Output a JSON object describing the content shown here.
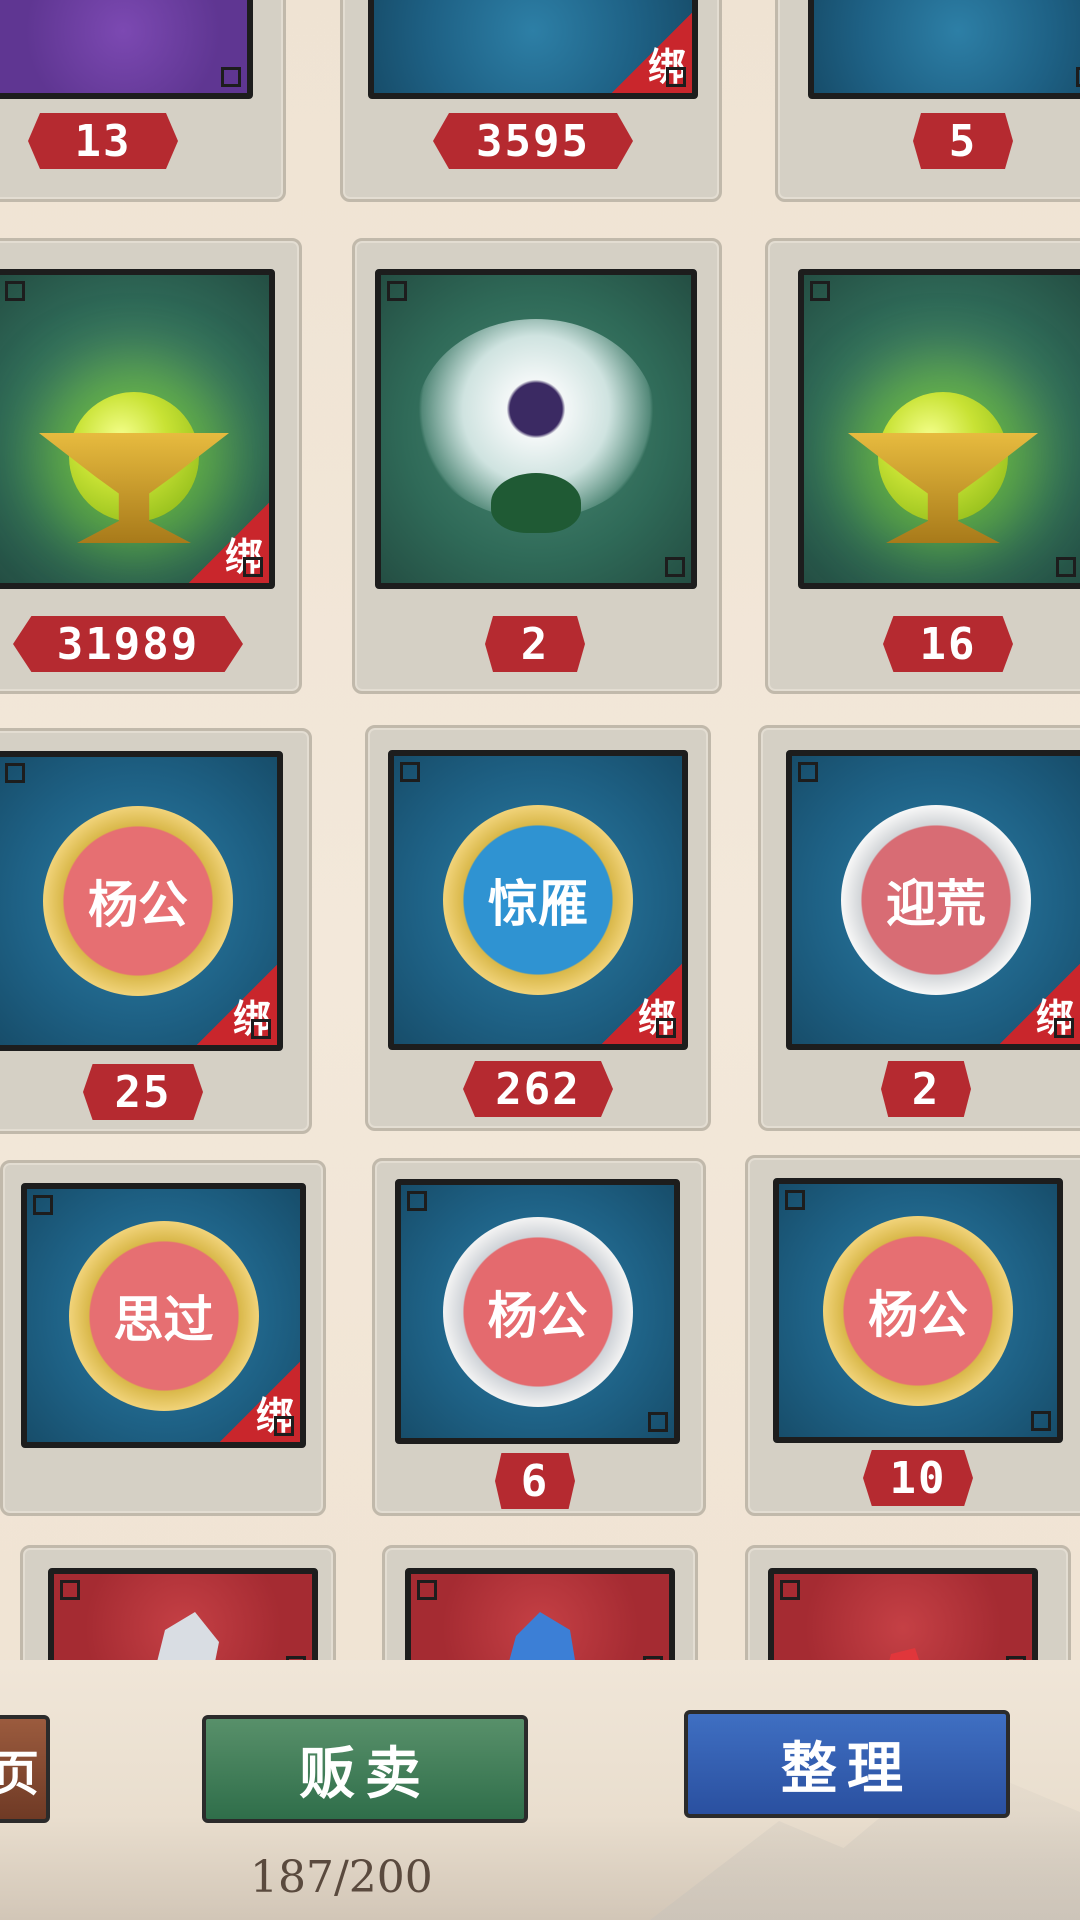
{
  "inventory": {
    "rows": [
      [
        {
          "qty": "13",
          "bound": false,
          "tile": "purple",
          "art": "cup"
        },
        {
          "qty": "3595",
          "bound": true,
          "tile": "blue",
          "art": "cup"
        },
        {
          "qty": "5",
          "bound": false,
          "tile": "blue",
          "art": "cup"
        }
      ],
      [
        {
          "qty": "31989",
          "bound": true,
          "tile": "green",
          "art": "orb-cup"
        },
        {
          "qty": "2",
          "bound": false,
          "tile": "green",
          "art": "flower"
        },
        {
          "qty": "16",
          "bound": false,
          "tile": "green",
          "art": "orb-cup"
        }
      ],
      [
        {
          "qty": "25",
          "bound": true,
          "tile": "blue",
          "art": "medal",
          "medal_text": "杨公",
          "medal_style": "gold"
        },
        {
          "qty": "262",
          "bound": true,
          "tile": "blue",
          "art": "medal",
          "medal_text": "惊雁",
          "medal_style": "gold-blue"
        },
        {
          "qty": "2",
          "bound": true,
          "tile": "blue",
          "art": "medal",
          "medal_text": "迎荒",
          "medal_style": "silver-red"
        }
      ],
      [
        {
          "qty": "",
          "bound": true,
          "tile": "blue",
          "art": "medal",
          "medal_text": "思过",
          "medal_style": "gold"
        },
        {
          "qty": "6",
          "bound": false,
          "tile": "blue",
          "art": "medal",
          "medal_text": "杨公",
          "medal_style": "silver"
        },
        {
          "qty": "10",
          "bound": false,
          "tile": "blue",
          "art": "medal",
          "medal_text": "杨公",
          "medal_style": "gold"
        }
      ],
      [
        {
          "qty": "",
          "bound": false,
          "tile": "red",
          "art": "shard-white"
        },
        {
          "qty": "",
          "bound": false,
          "tile": "red",
          "art": "shard-blue"
        },
        {
          "qty": "",
          "bound": false,
          "tile": "red",
          "art": "shard-red"
        }
      ]
    ],
    "bind_label": "绑"
  },
  "actions": {
    "left_partial_label": "页",
    "sell_label": "贩卖",
    "sort_label": "整理"
  },
  "capacity": "187/200",
  "colors": {
    "qty_badge": "#b52a30",
    "sell_button": "#2f6e4a",
    "sort_button": "#2a50a0"
  }
}
